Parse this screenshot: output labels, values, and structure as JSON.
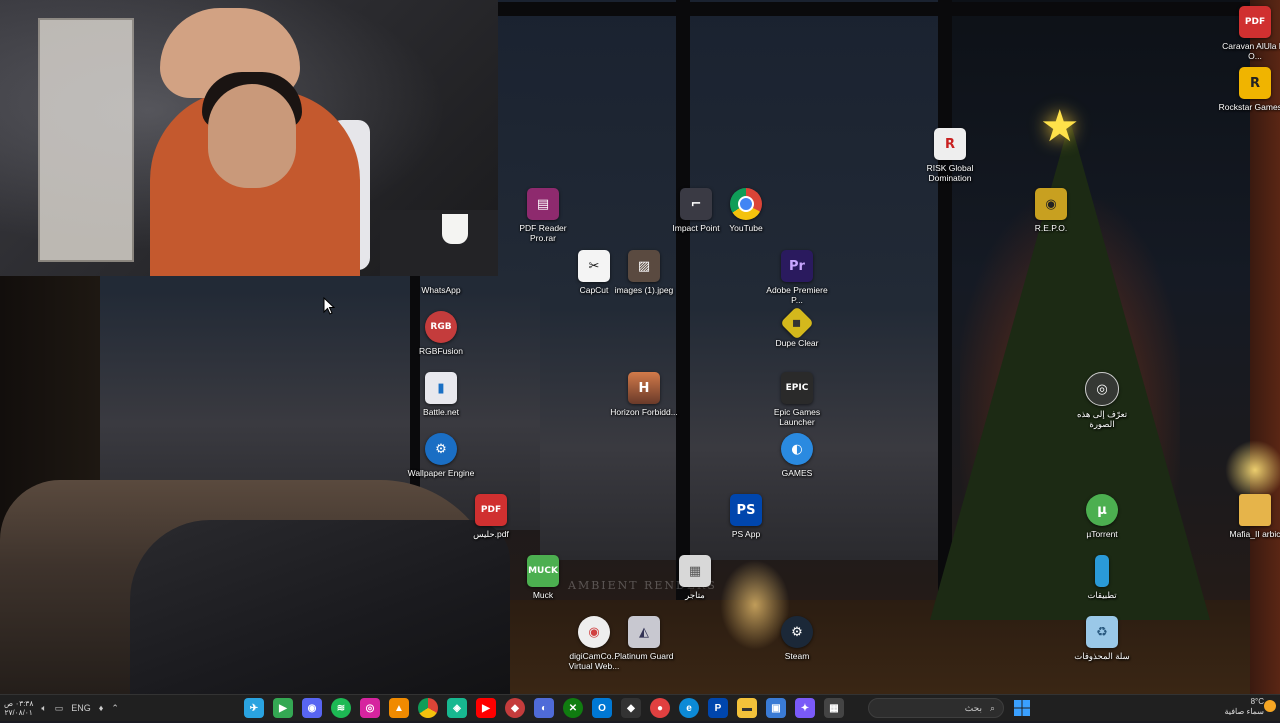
{
  "desktop": {
    "watermark": "AMBIENT RENDERS",
    "icons": [
      {
        "label": "PDF Reader Pro.rar",
        "icon": "winrar-archive-icon",
        "color": "#8e2a6e"
      },
      {
        "label": "Impact Point",
        "icon": "impact-point-icon",
        "color": "#3a3a44"
      },
      {
        "label": "YouTube",
        "icon": "chrome-icon",
        "color": "#db4437"
      },
      {
        "label": "WhatsApp",
        "icon": "whatsapp-icon",
        "color": "#25d366"
      },
      {
        "label": "CapCut",
        "icon": "capcut-icon",
        "color": "#111111"
      },
      {
        "label": "images (1).jpeg",
        "icon": "image-file-icon",
        "color": "#5a4a40"
      },
      {
        "label": "Adobe Premiere P...",
        "icon": "premiere-icon",
        "color": "#2a1a5e"
      },
      {
        "label": "RGBFusion",
        "icon": "rgbfusion-icon",
        "color": "#c43c3c"
      },
      {
        "label": "Dupe Clear",
        "icon": "dupe-clear-icon",
        "color": "#d4b81c"
      },
      {
        "label": "Battle.net",
        "icon": "battlenet-icon",
        "color": "#1a6fc4"
      },
      {
        "label": "Horizon Forbidd...",
        "icon": "horizon-game-icon",
        "color": "#c46a3a"
      },
      {
        "label": "Epic Games Launcher",
        "icon": "epic-games-icon",
        "color": "#2a2a2a"
      },
      {
        "label": "Wallpaper Engine",
        "icon": "wallpaper-engine-icon",
        "color": "#1a6ec4"
      },
      {
        "label": "GAMES",
        "icon": "games-folder-icon",
        "color": "#2a8ae0"
      },
      {
        "label": "حليس.pdf",
        "icon": "pdf-file-icon",
        "color": "#d03030"
      },
      {
        "label": "PS App",
        "icon": "playstation-icon",
        "color": "#0046ad"
      },
      {
        "label": "Muck",
        "icon": "muck-game-icon",
        "color": "#4caf50"
      },
      {
        "label": "متاجر",
        "icon": "stores-shortcut-icon",
        "color": "#d8d8d8"
      },
      {
        "label": "digiCamCo... Virtual Web...",
        "icon": "digicam-icon",
        "color": "#d04040"
      },
      {
        "label": "Platinum Guard",
        "icon": "platinum-guard-icon",
        "color": "#c8c8d0"
      },
      {
        "label": "Steam",
        "icon": "steam-icon",
        "color": "#1b2838"
      },
      {
        "label": "Caravan AlUla by O...",
        "icon": "pdf-file-icon",
        "color": "#d03030"
      },
      {
        "label": "Rockstar Games ...",
        "icon": "rockstar-icon",
        "color": "#f0b400"
      },
      {
        "label": "RISK Global Domination",
        "icon": "risk-game-icon",
        "color": "#c82020"
      },
      {
        "label": "R.E.P.O.",
        "icon": "repo-game-icon",
        "color": "#c8a020"
      },
      {
        "label": "تعرّف إلى هذه الصورة",
        "icon": "learn-about-picture-icon",
        "color": "#3a3a3a"
      },
      {
        "label": "µTorrent",
        "icon": "utorrent-icon",
        "color": "#4caf50"
      },
      {
        "label": "Mafia_II arbic",
        "icon": "folder-icon",
        "color": "#e6b44a"
      },
      {
        "label": "تطبيقات",
        "icon": "apps-folder-icon",
        "color": "#2a9ad8"
      },
      {
        "label": "سلة المحذوفات",
        "icon": "recycle-bin-icon",
        "color": "#9ac8e8"
      }
    ]
  },
  "taskbar": {
    "time": "٠٣:٣٨ ص",
    "date": "٢٧/٠٨/٠١",
    "language": "ENG",
    "search_placeholder": "بحث",
    "weather_temp": "8°C",
    "weather_desc": "سماء صافية",
    "apps": [
      {
        "name": "telegram-icon",
        "glyph": "✈",
        "color": "#2aa3e0"
      },
      {
        "name": "play-store-icon",
        "glyph": "▶",
        "color": "#34a853"
      },
      {
        "name": "discord-icon",
        "glyph": "◉",
        "color": "#5865f2"
      },
      {
        "name": "spotify-icon",
        "glyph": "●",
        "color": "#1db954"
      },
      {
        "name": "instagram-icon",
        "glyph": "◎",
        "color": "#d6249f"
      },
      {
        "name": "vlc-icon",
        "glyph": "▲",
        "color": "#f08a00"
      },
      {
        "name": "chrome-icon",
        "glyph": "◍",
        "color": "#db4437"
      },
      {
        "name": "capcut-taskbar-icon",
        "glyph": "◈",
        "color": "#17b890"
      },
      {
        "name": "youtube-icon",
        "glyph": "▶",
        "color": "#ff0000"
      },
      {
        "name": "rgbfusion-taskbar-icon",
        "glyph": "◆",
        "color": "#c43c3c"
      },
      {
        "name": "copilot-icon",
        "glyph": "◐",
        "color": "#4f6bd8"
      },
      {
        "name": "xbox-icon",
        "glyph": "✕",
        "color": "#107c10"
      },
      {
        "name": "outlook-icon",
        "glyph": "O",
        "color": "#0078d4"
      },
      {
        "name": "github-icon",
        "glyph": "◆",
        "color": "#333333"
      },
      {
        "name": "recorder-icon",
        "glyph": "●",
        "color": "#e04040"
      },
      {
        "name": "edge-icon",
        "glyph": "e",
        "color": "#0c8ad6"
      },
      {
        "name": "playstation-taskbar-icon",
        "glyph": "P",
        "color": "#0046ad"
      },
      {
        "name": "file-explorer-icon",
        "glyph": "▬",
        "color": "#f3c23a"
      },
      {
        "name": "store-icon",
        "glyph": "▣",
        "color": "#3a7bd5"
      },
      {
        "name": "copilot-app-icon",
        "glyph": "✦",
        "color": "#7a5af8"
      },
      {
        "name": "calculator-icon",
        "glyph": "▦",
        "color": "#444444"
      }
    ]
  }
}
